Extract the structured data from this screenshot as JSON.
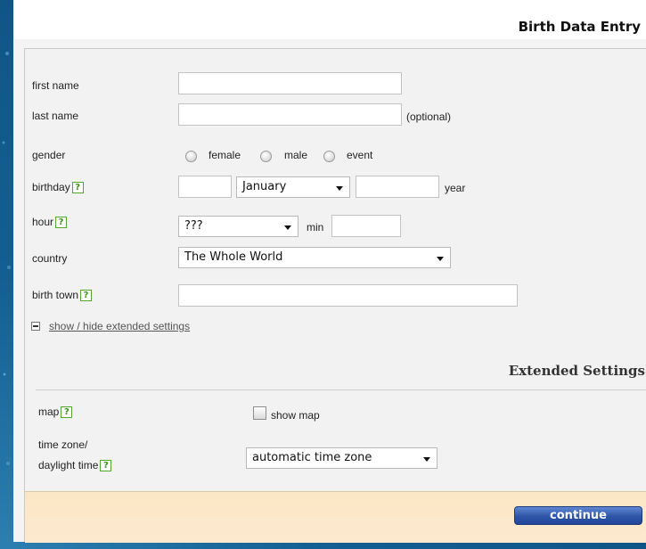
{
  "header": {
    "title": "Birth Data Entry"
  },
  "fields": {
    "first_name": {
      "label": "first name",
      "value": ""
    },
    "last_name": {
      "label": "last name",
      "value": "",
      "note": "(optional)"
    },
    "gender": {
      "label": "gender",
      "options": [
        "female",
        "male",
        "event"
      ]
    },
    "birthday": {
      "label": "birthday",
      "day": "",
      "month": "January",
      "year": "",
      "year_label": "year"
    },
    "hour": {
      "label": "hour",
      "value": "???",
      "min_label": "min",
      "min_value": ""
    },
    "country": {
      "label": "country",
      "value": "The Whole World"
    },
    "birth_town": {
      "label": "birth town",
      "value": ""
    }
  },
  "help_symbol": "?",
  "toggle_link": "show / hide extended settings",
  "extended": {
    "title": "Extended Settings",
    "map": {
      "label": "map",
      "checkbox_label": "show map"
    },
    "time_zone": {
      "label_line1": "time zone/",
      "label_line2": "daylight time",
      "value": "automatic time zone"
    }
  },
  "footer": {
    "continue_label": "continue"
  },
  "colors": {
    "accent": "#2e56a7",
    "footer_bg": "#fbe7c4",
    "help_green": "#55a62f"
  }
}
